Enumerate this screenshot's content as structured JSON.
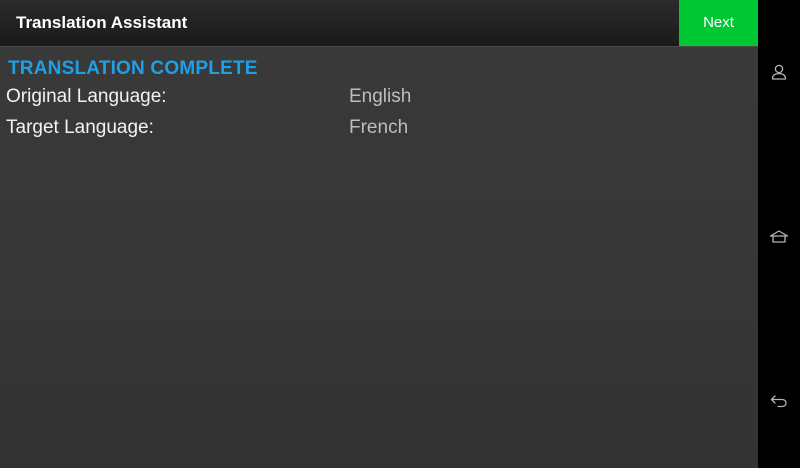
{
  "app": {
    "title": "Translation Assistant",
    "next_label": "Next",
    "accent_color": "#1ea0e6",
    "next_button_color": "#00c834"
  },
  "main": {
    "section_title": "TRANSLATION COMPLETE",
    "fields": [
      {
        "label": "Original Language:",
        "value": "English"
      },
      {
        "label": "Target Language:",
        "value": "French"
      }
    ]
  },
  "navbar": {
    "icons": [
      "user-icon",
      "home-icon",
      "back-icon"
    ]
  }
}
